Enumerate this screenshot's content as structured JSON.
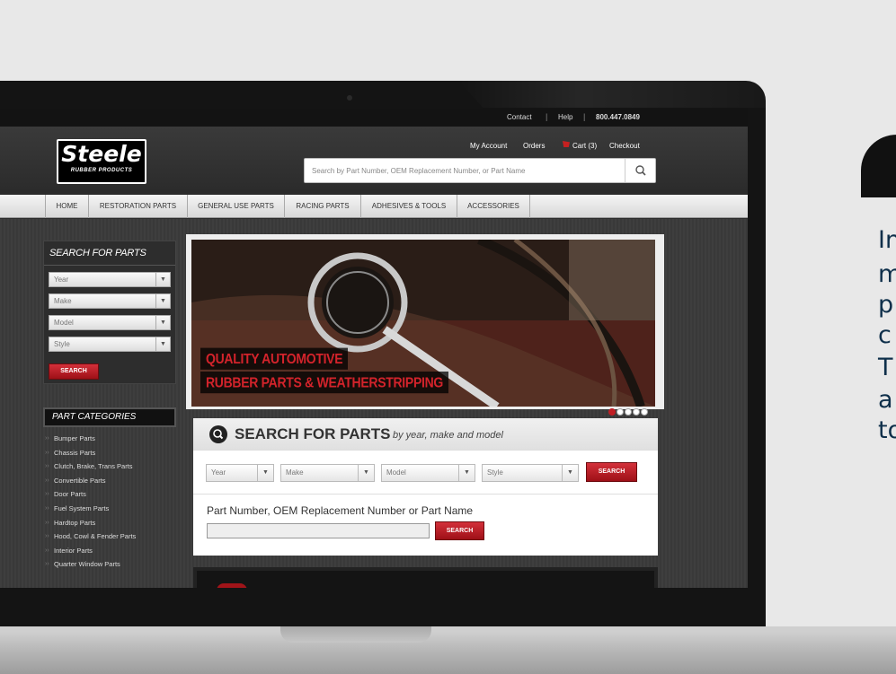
{
  "topbar": {
    "contact": "Contact",
    "help": "Help",
    "phone": "800.447.0849"
  },
  "logo": {
    "brand": "Steele",
    "tagline": "RUBBER PRODUCTS"
  },
  "account": {
    "my_account": "My Account",
    "orders": "Orders",
    "cart": "Cart (3)",
    "checkout": "Checkout"
  },
  "search": {
    "placeholder": "Search by Part Number, OEM Replacement Number, or Part Name"
  },
  "nav": {
    "items": [
      "HOME",
      "RESTORATION PARTS",
      "GENERAL USE PARTS",
      "RACING PARTS",
      "ADHESIVES & TOOLS",
      "ACCESSORIES"
    ]
  },
  "sidebar_search": {
    "title": "SEARCH FOR PARTS",
    "selects": [
      "Year",
      "Make",
      "Model",
      "Style"
    ],
    "button": "SEARCH"
  },
  "categories": {
    "title": "PART CATEGORIES",
    "items": [
      "Bumper Parts",
      "Chassis Parts",
      "Clutch, Brake, Trans Parts",
      "Convertible Parts",
      "Door Parts",
      "Fuel System Parts",
      "Hardtop Parts",
      "Hood, Cowl & Fender Parts",
      "Interior Parts",
      "Quarter Window Parts"
    ]
  },
  "hero": {
    "line1": "QUALITY AUTOMOTIVE",
    "line2": "RUBBER PARTS & WEATHERSTRIPPING",
    "slide_count": 5,
    "active_slide": 1
  },
  "main_search": {
    "title": "SEARCH FOR PARTS",
    "subtitle": "by year, make and model",
    "selects": [
      "Year",
      "Make",
      "Model",
      "Style"
    ],
    "button": "SEARCH",
    "part_label": "Part Number, OEM Replacement Number or Part Name",
    "part_button": "SEARCH"
  },
  "side_text": {
    "letters": [
      "In",
      "m",
      "p",
      "c",
      "T",
      "a",
      "to"
    ]
  },
  "colors": {
    "accent_red": "#c01e24",
    "brand_dark": "#141414"
  }
}
